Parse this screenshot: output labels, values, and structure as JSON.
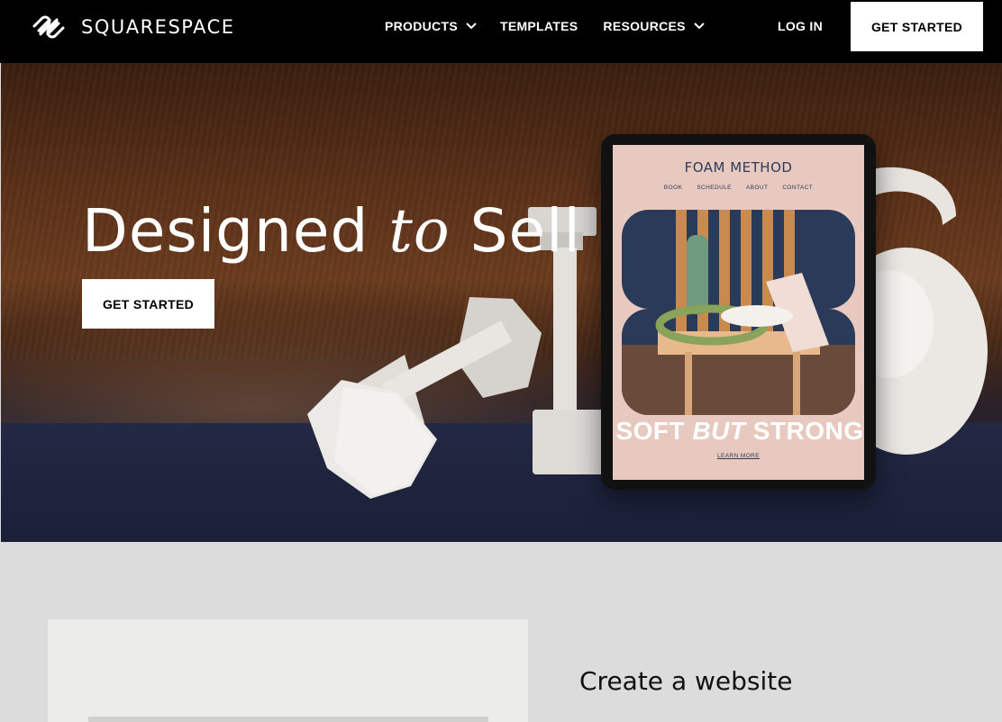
{
  "nav": {
    "brand": "SQUARESPACE",
    "links": [
      {
        "label": "PRODUCTS",
        "has_dropdown": true
      },
      {
        "label": "TEMPLATES",
        "has_dropdown": false
      },
      {
        "label": "RESOURCES",
        "has_dropdown": true
      }
    ],
    "login": "LOG IN",
    "cta": "GET STARTED"
  },
  "hero": {
    "title_part1": "Designed",
    "title_italic": "to",
    "title_part2": "Sell",
    "cta": "GET STARTED",
    "tablet": {
      "site_title": "FOAM METHOD",
      "menu": [
        "BOOK",
        "SCHEDULE",
        "ABOUT",
        "CONTACT"
      ],
      "headline_part1": "SOFT",
      "headline_italic": "BUT",
      "headline_part2": "STRONG",
      "learn_more": "LEARN MORE"
    }
  },
  "section": {
    "heading": "Create a website"
  },
  "colors": {
    "nav_bg": "#000000",
    "button_bg": "#ffffff",
    "page_bg": "#dcdcdc",
    "panel_bg": "#ececea",
    "tablet_text": "#2e3b5a"
  },
  "icons": [
    "squarespace-logo-icon",
    "chevron-down-icon"
  ]
}
